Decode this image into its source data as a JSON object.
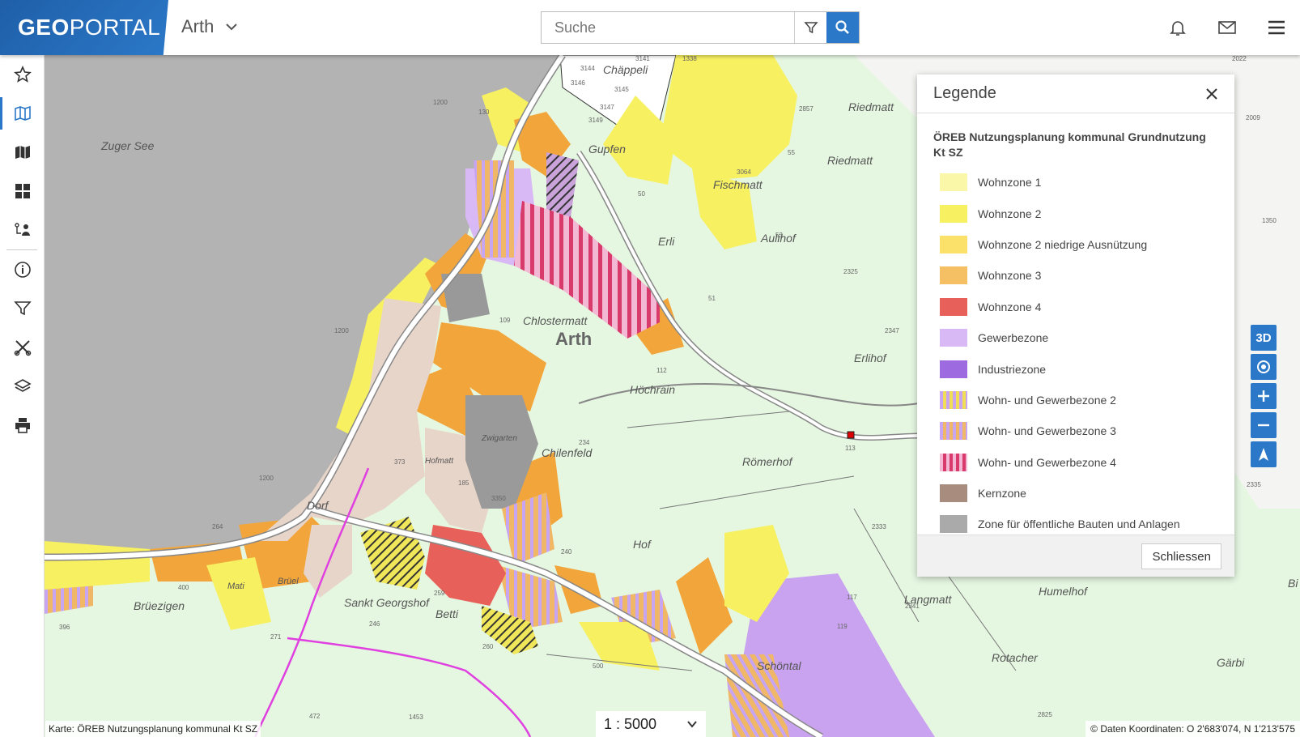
{
  "header": {
    "logo_bold": "GEO",
    "logo_rest": "PORTAL",
    "municipality": "Arth",
    "search_placeholder": "Suche"
  },
  "sidebar": {
    "items": [
      {
        "icon": "star-icon"
      },
      {
        "icon": "map-icon",
        "active": true
      },
      {
        "icon": "map-layers-icon"
      },
      {
        "icon": "grid-icon"
      },
      {
        "icon": "user-route-icon"
      },
      {
        "icon": "info-icon"
      },
      {
        "icon": "filter-icon"
      },
      {
        "icon": "measure-tools-icon"
      },
      {
        "icon": "layers-icon"
      },
      {
        "icon": "print-icon"
      }
    ]
  },
  "map": {
    "places": [
      {
        "label": "Zuger See"
      },
      {
        "label": "Chäppeli"
      },
      {
        "label": "Gupfen"
      },
      {
        "label": "Fischmatt"
      },
      {
        "label": "Riedmatt"
      },
      {
        "label": "Riedmatt"
      },
      {
        "label": "Erli"
      },
      {
        "label": "Aulihof"
      },
      {
        "label": "Chlostermatt"
      },
      {
        "label": "Arth"
      },
      {
        "label": "Erlihof"
      },
      {
        "label": "Höchrain"
      },
      {
        "label": "Chilenfeld"
      },
      {
        "label": "Zwigarten"
      },
      {
        "label": "Hofmatt"
      },
      {
        "label": "Römerhof"
      },
      {
        "label": "Dorf"
      },
      {
        "label": "Hof"
      },
      {
        "label": "Brüezigen"
      },
      {
        "label": "Sankt Georgshof"
      },
      {
        "label": "Betti"
      },
      {
        "label": "Langmatt"
      },
      {
        "label": "Humelhof"
      },
      {
        "label": "Rotacher"
      },
      {
        "label": "Gärbi"
      },
      {
        "label": "Schöntal"
      },
      {
        "label": "Brüel"
      },
      {
        "label": "Mati"
      },
      {
        "label": "Bi"
      }
    ],
    "parcels": [
      "3144",
      "3141",
      "3146",
      "3145",
      "3147",
      "1200",
      "130",
      "2857",
      "3064",
      "2325",
      "50",
      "51",
      "109",
      "112",
      "234",
      "113",
      "3350",
      "185",
      "373",
      "1200",
      "1200",
      "264",
      "400",
      "396",
      "271",
      "246",
      "259",
      "260",
      "240",
      "117",
      "119",
      "2333",
      "2341",
      "500",
      "472",
      "1453",
      "2825",
      "2022",
      "2009",
      "2335",
      "3149",
      "1338",
      "53",
      "55",
      "2347",
      "1350"
    ]
  },
  "legend": {
    "title": "Legende",
    "layer_name": "ÖREB Nutzungsplanung kommunal Grundnutzung Kt SZ",
    "items": [
      {
        "label": "Wohnzone 1",
        "color": "#fbf7a8",
        "pattern": "solid"
      },
      {
        "label": "Wohnzone 2",
        "color": "#f7f061",
        "pattern": "solid"
      },
      {
        "label": "Wohnzone 2 niedrige Ausnützung",
        "color": "#fbe06a",
        "pattern": "solid"
      },
      {
        "label": "Wohnzone 3",
        "color": "#f5c064",
        "pattern": "solid"
      },
      {
        "label": "Wohnzone 4",
        "color": "#e8605a",
        "pattern": "solid"
      },
      {
        "label": "Gewerbezone",
        "color": "#d9b9f5",
        "pattern": "solid"
      },
      {
        "label": "Industriezone",
        "color": "#9d6adf",
        "pattern": "solid"
      },
      {
        "label": "Wohn- und Gewerbezone 2",
        "color": "#f2dd56",
        "pattern": "stripe",
        "stripe": "#c8a5f0"
      },
      {
        "label": "Wohn- und Gewerbezone 3",
        "color": "#f0b766",
        "pattern": "stripe",
        "stripe": "#c8a5f0"
      },
      {
        "label": "Wohn- und Gewerbezone 4",
        "color": "#d83a6c",
        "pattern": "stripe",
        "stripe": "#f2b8d4"
      },
      {
        "label": "Kernzone",
        "color": "#a88d7f",
        "pattern": "solid"
      },
      {
        "label": "Zone für öffentliche Bauten und Anlagen",
        "color": "#aaaaaa",
        "pattern": "solid"
      }
    ],
    "close_label": "Schliessen"
  },
  "controls": {
    "three_d": "3D"
  },
  "footer": {
    "map_credit": "Karte: ÖREB Nutzungsplanung kommunal Kt SZ",
    "scale": "1 : 5000",
    "coords": "© Daten   Koordinaten: O 2'683'074, N 1'213'575"
  },
  "colors": {
    "brand_blue": "#2b78c8",
    "lake": "#b3b3b3",
    "zone_default": "#e5f7e1"
  }
}
